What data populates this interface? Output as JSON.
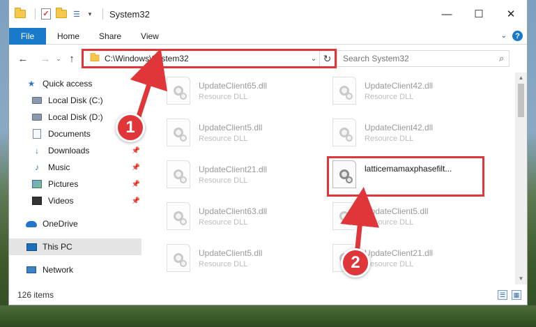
{
  "window": {
    "title": "System32",
    "controls": {
      "minimize": "—",
      "maximize": "☐",
      "close": "✕"
    }
  },
  "ribbon": {
    "tabs": [
      "File",
      "Home",
      "Share",
      "View"
    ],
    "help": "?"
  },
  "nav": {
    "back": "←",
    "forward": "→",
    "recent": "⌄",
    "up": "↑",
    "address": "C:\\Windows\\System32",
    "refresh": "↻"
  },
  "search": {
    "placeholder": "Search System32"
  },
  "sidebar": {
    "items": [
      {
        "label": "Quick access",
        "icon": "star-icon"
      },
      {
        "label": "Local Disk (C:)",
        "icon": "disk-icon"
      },
      {
        "label": "Local Disk (D:)",
        "icon": "disk-icon"
      },
      {
        "label": "Documents",
        "icon": "documents-icon"
      },
      {
        "label": "Downloads",
        "icon": "downloads-icon",
        "pinned": true
      },
      {
        "label": "Music",
        "icon": "music-icon",
        "pinned": true
      },
      {
        "label": "Pictures",
        "icon": "pictures-icon",
        "pinned": true
      },
      {
        "label": "Videos",
        "icon": "videos-icon",
        "pinned": true
      },
      {
        "label": "OneDrive",
        "icon": "cloud-icon"
      },
      {
        "label": "This PC",
        "icon": "computer-icon",
        "selected": true
      },
      {
        "label": "Network",
        "icon": "network-icon"
      }
    ]
  },
  "files": [
    {
      "name": "UpdateClient65.dll",
      "type": "Resource DLL"
    },
    {
      "name": "UpdateClient42.dll",
      "type": "Resource DLL"
    },
    {
      "name": "UpdateClient5.dll",
      "type": "Resource DLL"
    },
    {
      "name": "UpdateClient42.dll",
      "type": "Resource DLL"
    },
    {
      "name": "UpdateClient21.dll",
      "type": "Resource DLL"
    },
    {
      "name": "latticemamaxphasefilt...",
      "type": ""
    },
    {
      "name": "UpdateClient63.dll",
      "type": "Resource DLL"
    },
    {
      "name": "UpdateClient5.dll",
      "type": "Resource DLL"
    },
    {
      "name": "UpdateClient5.dll",
      "type": "Resource DLL"
    },
    {
      "name": "UpdateClient21.dll",
      "type": "Resource DLL"
    }
  ],
  "status": {
    "item_count": "126 items"
  },
  "markers": {
    "step1": "1",
    "step2": "2"
  },
  "colors": {
    "accent": "#1979ca",
    "highlight": "#e0363a"
  }
}
